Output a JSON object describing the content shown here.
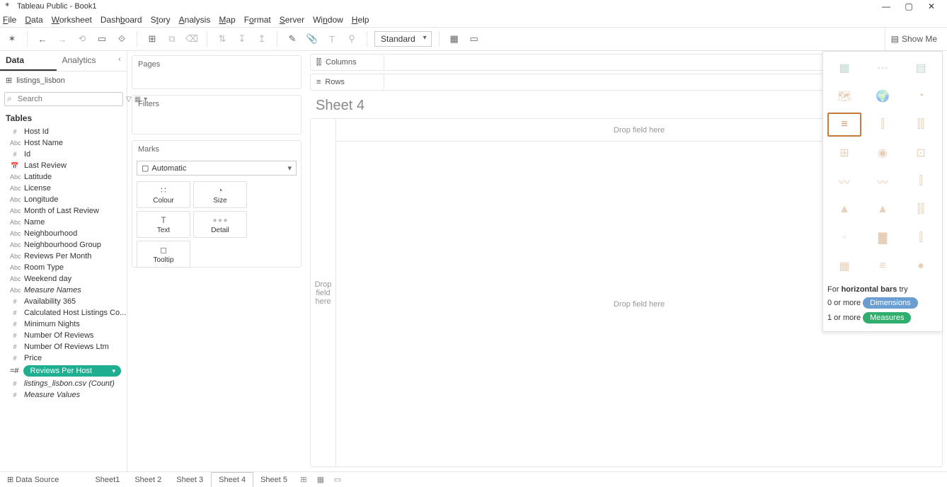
{
  "app": {
    "title": "Tableau Public - Book1"
  },
  "menu": [
    "File",
    "Data",
    "Worksheet",
    "Dashboard",
    "Story",
    "Analysis",
    "Map",
    "Format",
    "Server",
    "Window",
    "Help"
  ],
  "toolbar": {
    "fit_mode": "Standard",
    "showme_label": "Show Me"
  },
  "leftpanel": {
    "tabs": {
      "data": "Data",
      "analytics": "Analytics"
    },
    "datasource": "listings_lisbon",
    "search_placeholder": "Search",
    "tables_label": "Tables",
    "fields": [
      {
        "type": "#",
        "label": "Host Id",
        "italic": false,
        "selected": false
      },
      {
        "type": "Abc",
        "label": "Host Name",
        "italic": false,
        "selected": false
      },
      {
        "type": "#",
        "label": "Id",
        "italic": false,
        "selected": false
      },
      {
        "type": "📅",
        "label": "Last Review",
        "italic": false,
        "selected": false
      },
      {
        "type": "Abc",
        "label": "Latitude",
        "italic": false,
        "selected": false
      },
      {
        "type": "Abc",
        "label": "License",
        "italic": false,
        "selected": false
      },
      {
        "type": "Abc",
        "label": "Longitude",
        "italic": false,
        "selected": false
      },
      {
        "type": "Abc",
        "label": "Month of Last Review",
        "italic": false,
        "selected": false
      },
      {
        "type": "Abc",
        "label": "Name",
        "italic": false,
        "selected": false
      },
      {
        "type": "Abc",
        "label": "Neighbourhood",
        "italic": false,
        "selected": false
      },
      {
        "type": "Abc",
        "label": "Neighbourhood Group",
        "italic": false,
        "selected": false
      },
      {
        "type": "Abc",
        "label": "Reviews Per Month",
        "italic": false,
        "selected": false
      },
      {
        "type": "Abc",
        "label": "Room Type",
        "italic": false,
        "selected": false
      },
      {
        "type": "Abc",
        "label": "Weekend day",
        "italic": false,
        "selected": false
      },
      {
        "type": "Abc",
        "label": "Measure Names",
        "italic": true,
        "selected": false
      },
      {
        "type": "#",
        "label": "Availability 365",
        "italic": false,
        "selected": false
      },
      {
        "type": "#",
        "label": "Calculated Host Listings Co...",
        "italic": false,
        "selected": false
      },
      {
        "type": "#",
        "label": "Minimum Nights",
        "italic": false,
        "selected": false
      },
      {
        "type": "#",
        "label": "Number Of Reviews",
        "italic": false,
        "selected": false
      },
      {
        "type": "#",
        "label": "Number Of Reviews Ltm",
        "italic": false,
        "selected": false
      },
      {
        "type": "#",
        "label": "Price",
        "italic": false,
        "selected": false
      },
      {
        "type": "=#",
        "label": "Reviews Per Host",
        "italic": false,
        "selected": true
      },
      {
        "type": "#",
        "label": "listings_lisbon.csv (Count)",
        "italic": true,
        "selected": false
      },
      {
        "type": "#",
        "label": "Measure Values",
        "italic": true,
        "selected": false
      }
    ]
  },
  "shelves": {
    "pages": "Pages",
    "filters": "Filters",
    "marks": "Marks",
    "marks_type": "Automatic",
    "marks_btns": {
      "colour": "Colour",
      "size": "Size",
      "text": "Text",
      "detail": "Detail",
      "tooltip": "Tooltip"
    }
  },
  "cr": {
    "columns": "Columns",
    "rows": "Rows"
  },
  "sheet": {
    "title": "Sheet 4",
    "drop_top": "Drop field here",
    "drop_left": "Drop\nfield\nhere",
    "drop_center": "Drop field here"
  },
  "showme": {
    "hint_for": "For ",
    "hint_type": "horizontal bars",
    "hint_try": " try",
    "line1_prefix": "0 or more ",
    "line1_badge": "Dimensions",
    "line2_prefix": "1 or more ",
    "line2_badge": "Measures"
  },
  "bottom": {
    "datasource": "Data Source",
    "sheets": [
      "Sheet1",
      "Sheet 2",
      "Sheet 3",
      "Sheet 4",
      "Sheet 5"
    ],
    "active": "Sheet 4"
  }
}
